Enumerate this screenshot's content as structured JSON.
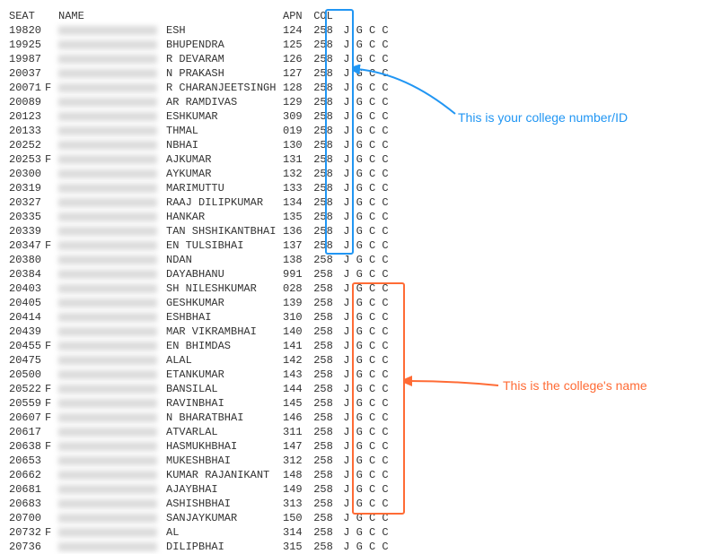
{
  "headers": {
    "seat": "SEAT",
    "name": "NAME",
    "apn": "APN",
    "col": "COL"
  },
  "annotations": {
    "college_id": "This is your college number/ID",
    "college_name": "This is the college's name"
  },
  "rows": [
    {
      "seat": "19820",
      "f": "",
      "suffix": "ESH",
      "apn": "124",
      "col": "258",
      "rest": "J G C C"
    },
    {
      "seat": "19925",
      "f": "",
      "suffix": "BHUPENDRA",
      "apn": "125",
      "col": "258",
      "rest": "J G C C"
    },
    {
      "seat": "19987",
      "f": "",
      "suffix": "R DEVARAM",
      "apn": "126",
      "col": "258",
      "rest": "J G C C"
    },
    {
      "seat": "20037",
      "f": "",
      "suffix": "N PRAKASH",
      "apn": "127",
      "col": "258",
      "rest": "J G C C"
    },
    {
      "seat": "20071",
      "f": "F",
      "suffix": "R CHARANJEETSINGH",
      "apn": "128",
      "col": "258",
      "rest": "J G C C"
    },
    {
      "seat": "20089",
      "f": "",
      "suffix": "AR RAMDIVAS",
      "apn": "129",
      "col": "258",
      "rest": "J G C C"
    },
    {
      "seat": "20123",
      "f": "",
      "suffix": "ESHKUMAR",
      "apn": "309",
      "col": "258",
      "rest": "J G C C"
    },
    {
      "seat": "20133",
      "f": "",
      "suffix": "THMAL",
      "apn": "019",
      "col": "258",
      "rest": "J G C C"
    },
    {
      "seat": "20252",
      "f": "",
      "suffix": "NBHAI",
      "apn": "130",
      "col": "258",
      "rest": "J G C C"
    },
    {
      "seat": "20253",
      "f": "F",
      "suffix": "AJKUMAR",
      "apn": "131",
      "col": "258",
      "rest": "J G C C"
    },
    {
      "seat": "20300",
      "f": "",
      "suffix": "AYKUMAR",
      "apn": "132",
      "col": "258",
      "rest": "J G C C"
    },
    {
      "seat": "20319",
      "f": "",
      "suffix": "MARIMUTTU",
      "apn": "133",
      "col": "258",
      "rest": "J G C C"
    },
    {
      "seat": "20327",
      "f": "",
      "suffix": "RAAJ DILIPKUMAR",
      "apn": "134",
      "col": "258",
      "rest": "J G C C"
    },
    {
      "seat": "20335",
      "f": "",
      "suffix": "HANKAR",
      "apn": "135",
      "col": "258",
      "rest": "J G C C"
    },
    {
      "seat": "20339",
      "f": "",
      "suffix": "TAN SHSHIKANTBHAI",
      "apn": "136",
      "col": "258",
      "rest": "J G C C"
    },
    {
      "seat": "20347",
      "f": "F",
      "suffix": "EN TULSIBHAI",
      "apn": "137",
      "col": "258",
      "rest": "J G C C"
    },
    {
      "seat": "20380",
      "f": "",
      "suffix": "NDAN",
      "apn": "138",
      "col": "258",
      "rest": "J G C C"
    },
    {
      "seat": "20384",
      "f": "",
      "suffix": "DAYABHANU",
      "apn": "991",
      "col": "258",
      "rest": "J G C C"
    },
    {
      "seat": "20403",
      "f": "",
      "suffix": "SH NILESHKUMAR",
      "apn": "028",
      "col": "258",
      "rest": "J G C C"
    },
    {
      "seat": "20405",
      "f": "",
      "suffix": "GESHKUMAR",
      "apn": "139",
      "col": "258",
      "rest": "J G C C"
    },
    {
      "seat": "20414",
      "f": "",
      "suffix": "ESHBHAI",
      "apn": "310",
      "col": "258",
      "rest": "J G C C"
    },
    {
      "seat": "20439",
      "f": "",
      "suffix": "MAR VIKRAMBHAI",
      "apn": "140",
      "col": "258",
      "rest": "J G C C"
    },
    {
      "seat": "20455",
      "f": "F",
      "suffix": "EN BHIMDAS",
      "apn": "141",
      "col": "258",
      "rest": "J G C C"
    },
    {
      "seat": "20475",
      "f": "",
      "suffix": "ALAL",
      "apn": "142",
      "col": "258",
      "rest": "J G C C"
    },
    {
      "seat": "20500",
      "f": "",
      "suffix": "ETANKUMAR",
      "apn": "143",
      "col": "258",
      "rest": "J G C C"
    },
    {
      "seat": "20522",
      "f": "F",
      "suffix": "BANSILAL",
      "apn": "144",
      "col": "258",
      "rest": "J G C C"
    },
    {
      "seat": "20559",
      "f": "F",
      "suffix": "RAVINBHAI",
      "apn": "145",
      "col": "258",
      "rest": "J G C C"
    },
    {
      "seat": "20607",
      "f": "F",
      "suffix": "N BHARATBHAI",
      "apn": "146",
      "col": "258",
      "rest": "J G C C"
    },
    {
      "seat": "20617",
      "f": "",
      "suffix": "ATVARLAL",
      "apn": "311",
      "col": "258",
      "rest": "J G C C"
    },
    {
      "seat": "20638",
      "f": "F",
      "suffix": "HASMUKHBHAI",
      "apn": "147",
      "col": "258",
      "rest": "J G C C"
    },
    {
      "seat": "20653",
      "f": "",
      "suffix": "MUKESHBHAI",
      "apn": "312",
      "col": "258",
      "rest": "J G C C"
    },
    {
      "seat": "20662",
      "f": "",
      "suffix": "KUMAR RAJANIKANT",
      "apn": "148",
      "col": "258",
      "rest": "J G C C"
    },
    {
      "seat": "20681",
      "f": "",
      "suffix": "AJAYBHAI",
      "apn": "149",
      "col": "258",
      "rest": "J G C C"
    },
    {
      "seat": "20683",
      "f": "",
      "suffix": "ASHISHBHAI",
      "apn": "313",
      "col": "258",
      "rest": "J G C C"
    },
    {
      "seat": "20700",
      "f": "",
      "suffix": "SANJAYKUMAR",
      "apn": "150",
      "col": "258",
      "rest": "J G C C"
    },
    {
      "seat": "20732",
      "f": "F",
      "suffix": "AL",
      "apn": "314",
      "col": "258",
      "rest": "J G C C"
    },
    {
      "seat": "20736",
      "f": "",
      "suffix": "DILIPBHAI",
      "apn": "315",
      "col": "258",
      "rest": "J G C C"
    }
  ]
}
